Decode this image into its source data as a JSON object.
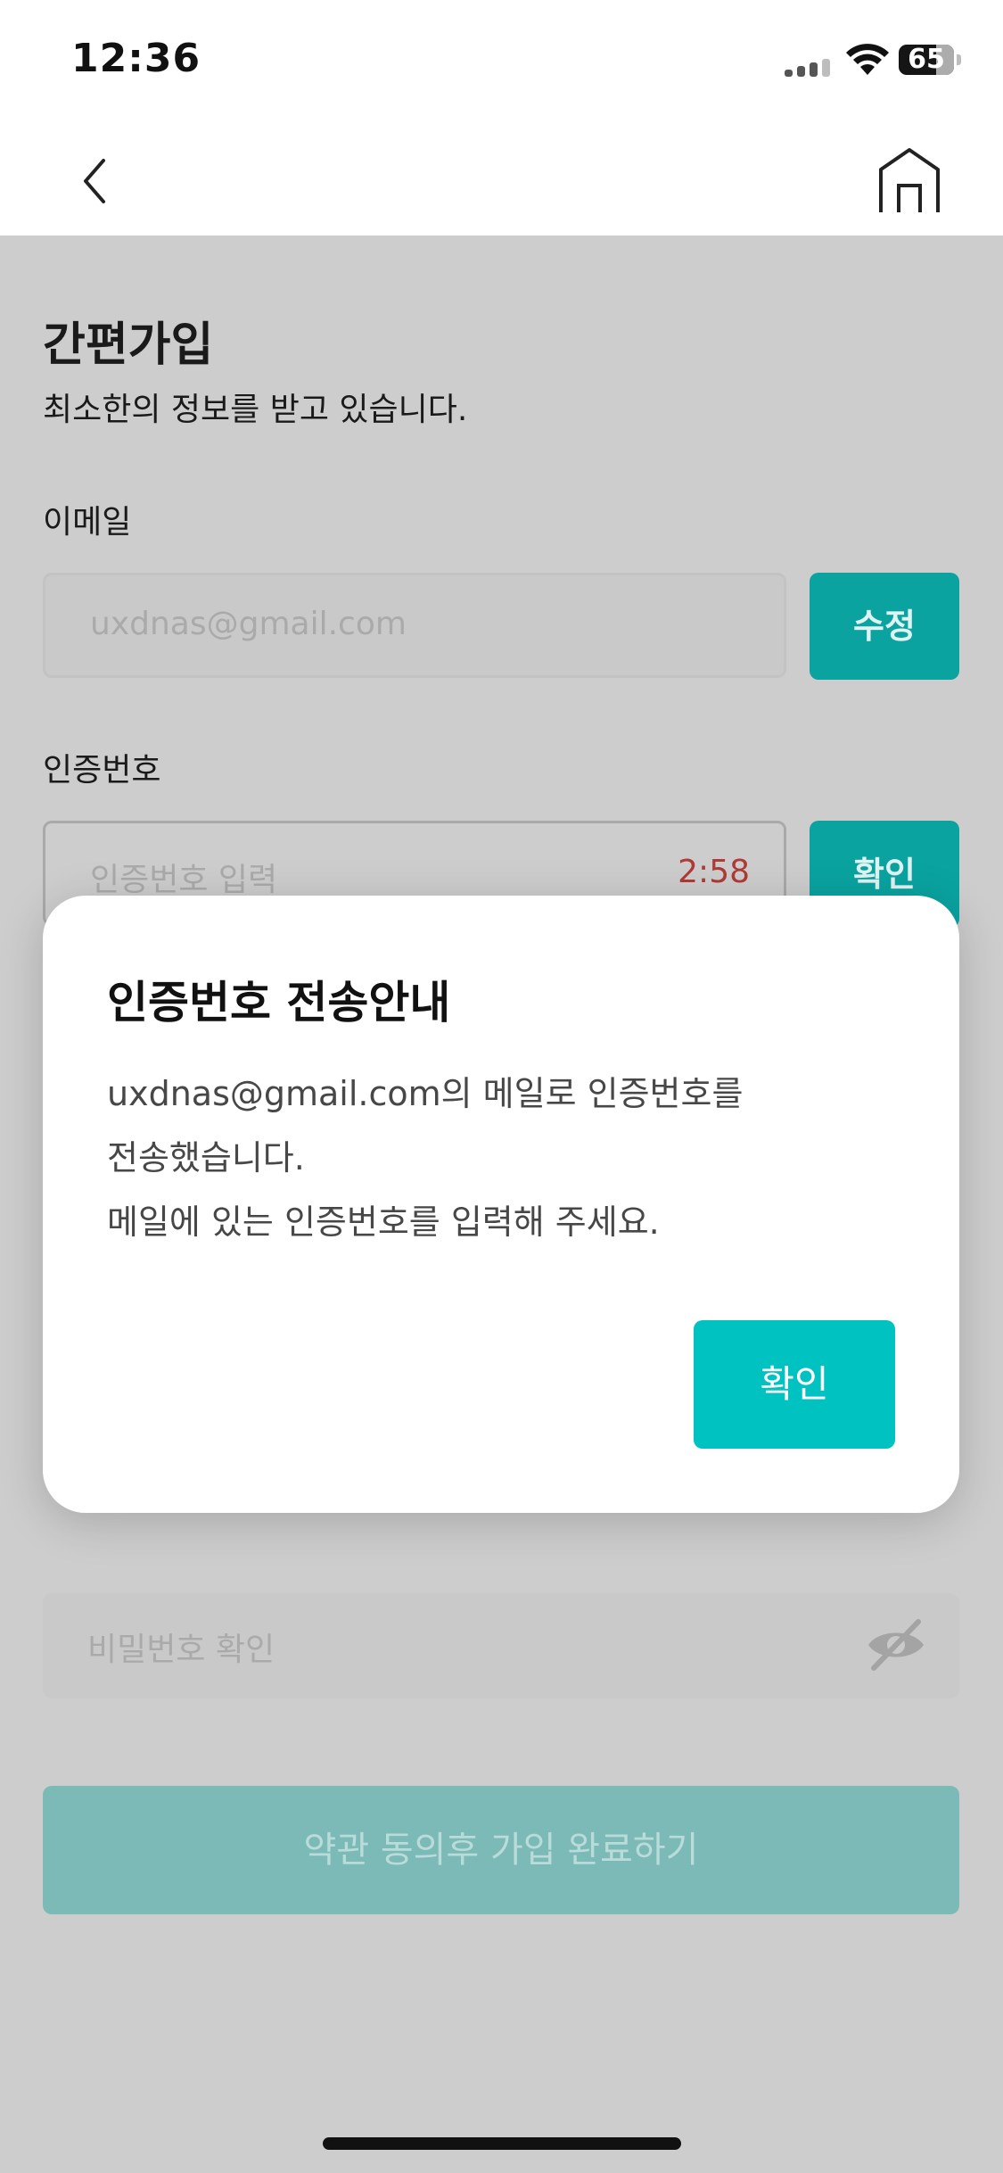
{
  "status_bar": {
    "time": "12:36",
    "battery": "65",
    "icons": [
      "signal-icon",
      "wifi-icon",
      "battery-icon"
    ]
  },
  "nav": {
    "icons": [
      "back-chevron-icon",
      "home-icon"
    ]
  },
  "page": {
    "title": "간편가입",
    "subtitle": "최소한의 정보를 받고 있습니다.",
    "email": {
      "label": "이메일",
      "value": "uxdnas@gmail.com",
      "button": "수정"
    },
    "code": {
      "label": "인증번호",
      "placeholder": "인증번호 입력",
      "timer": "2:58",
      "button": "확인"
    },
    "password_confirm": {
      "placeholder": "비밀번호 확인",
      "icon": "eye-off-icon"
    },
    "submit_button": "약관 동의후 가입 완료하기"
  },
  "modal": {
    "title": "인증번호 전송안내",
    "lines": [
      "uxdnas@gmail.com의 메일로 인증번호를",
      "전송했습니다.",
      "메일에 있는 인증번호를 입력해 주세요."
    ],
    "confirm": "확인"
  },
  "colors": {
    "accent": "#00C2C0",
    "timer": "#B03A35",
    "overlay_bg": "#CDCDCD"
  }
}
